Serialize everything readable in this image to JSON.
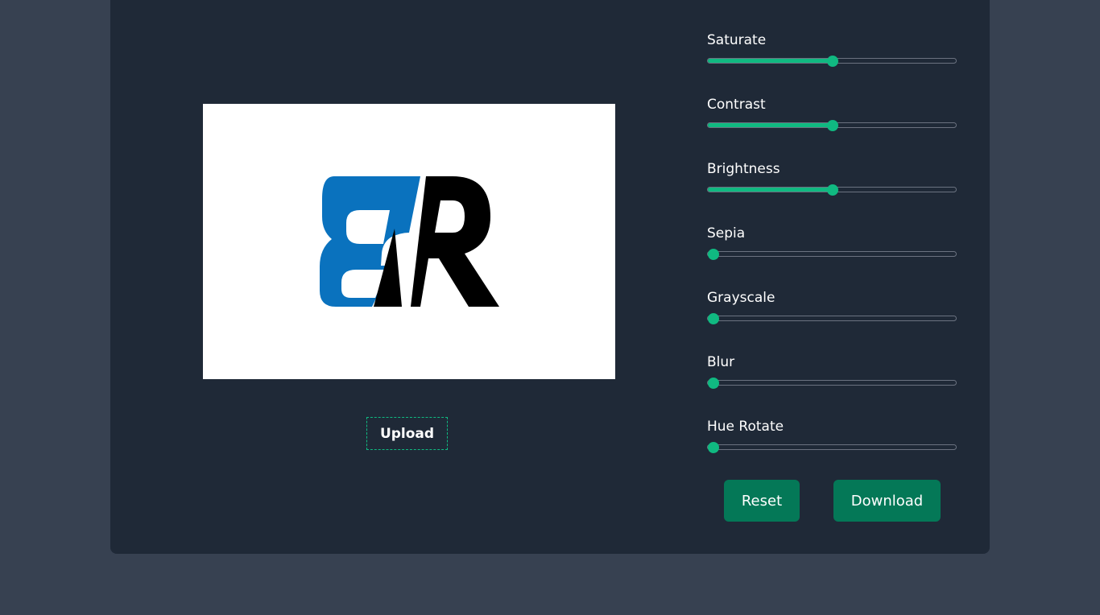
{
  "preview": {
    "logo_text": "BR",
    "logo_colors": {
      "blue": "#0A72BE",
      "black": "#000000"
    }
  },
  "upload": {
    "label": "Upload"
  },
  "filters": [
    {
      "label": "Saturate",
      "value_fraction": 0.5
    },
    {
      "label": "Contrast",
      "value_fraction": 0.5
    },
    {
      "label": "Brightness",
      "value_fraction": 0.5
    },
    {
      "label": "Sepia",
      "value_fraction": 0
    },
    {
      "label": "Grayscale",
      "value_fraction": 0
    },
    {
      "label": "Blur",
      "value_fraction": 0
    },
    {
      "label": "Hue Rotate",
      "value_fraction": 0
    }
  ],
  "buttons": {
    "reset": "Reset",
    "download": "Download"
  },
  "colors": {
    "accent": "#10B981",
    "button": "#047857",
    "panel": "#1F2937",
    "background": "#374151"
  }
}
